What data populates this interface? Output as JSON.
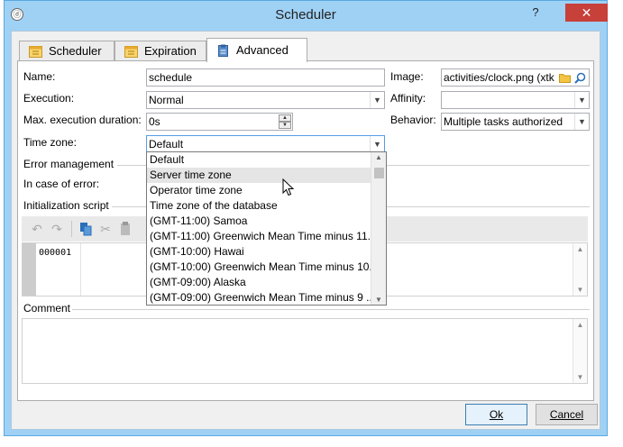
{
  "window": {
    "title": "Scheduler",
    "help_label": "?",
    "close_label": "✕"
  },
  "tabs": [
    {
      "label": "Scheduler",
      "icon": "calendar-icon",
      "active": false
    },
    {
      "label": "Expiration",
      "icon": "calendar-icon",
      "active": false
    },
    {
      "label": "Advanced",
      "icon": "clipboard-icon",
      "active": true
    }
  ],
  "form": {
    "name_label": "Name:",
    "name_value": "schedule",
    "execution_label": "Execution:",
    "execution_value": "Normal",
    "max_duration_label": "Max. execution duration:",
    "max_duration_value": "0s",
    "timezone_label": "Time zone:",
    "timezone_value": "Default",
    "image_label": "Image:",
    "image_value": "activities/clock.png (xtk",
    "affinity_label": "Affinity:",
    "affinity_value": "",
    "behavior_label": "Behavior:",
    "behavior_value": "Multiple tasks authorized"
  },
  "error_management": {
    "section_label": "Error management",
    "in_case_label": "In case of error:"
  },
  "init_script": {
    "section_label": "Initialization script",
    "line_number": "000001"
  },
  "comment": {
    "section_label": "Comment"
  },
  "buttons": {
    "ok_label": "Ok",
    "cancel_label": "Cancel"
  },
  "timezone_dropdown": {
    "hovered_index": 1,
    "options": [
      "Default",
      "Server time zone",
      "Operator time zone",
      "Time zone of the database",
      "(GMT-11:00) Samoa",
      "(GMT-11:00) Greenwich Mean Time minus 11...",
      "(GMT-10:00) Hawai",
      "(GMT-10:00) Greenwich Mean Time minus 10...",
      "(GMT-09:00) Alaska",
      "(GMT-09:00) Greenwich Mean Time minus 9 ..."
    ]
  },
  "colors": {
    "titlebar": "#9fd1f5",
    "close_button": "#c7403a",
    "default_button_border": "#3c7fb1"
  }
}
